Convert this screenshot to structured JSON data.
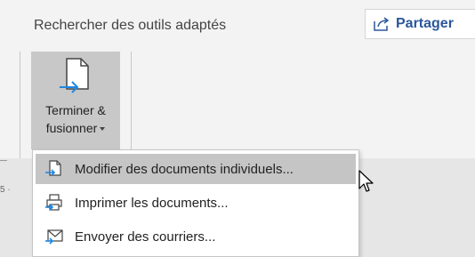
{
  "ribbon": {
    "tell_me_text": "Rechercher des outils adaptés",
    "share_label": "Partager",
    "finish_merge": {
      "label_line1": "Terminer &",
      "label_line2": "fusionner"
    }
  },
  "ruler": {
    "tick_text": "5 ·"
  },
  "menu": {
    "items": [
      {
        "label": "Modifier des documents individuels...",
        "icon": "edit-documents-icon",
        "highlighted": true
      },
      {
        "label": "Imprimer les documents...",
        "icon": "printer-icon",
        "highlighted": false
      },
      {
        "label": "Envoyer des courriers...",
        "icon": "envelope-icon",
        "highlighted": false
      }
    ]
  },
  "colors": {
    "accent": "#2b579a",
    "arrow_blue": "#1e88e5",
    "highlight": "#c5c5c5",
    "ribbon_bg": "#f3f3f3"
  }
}
